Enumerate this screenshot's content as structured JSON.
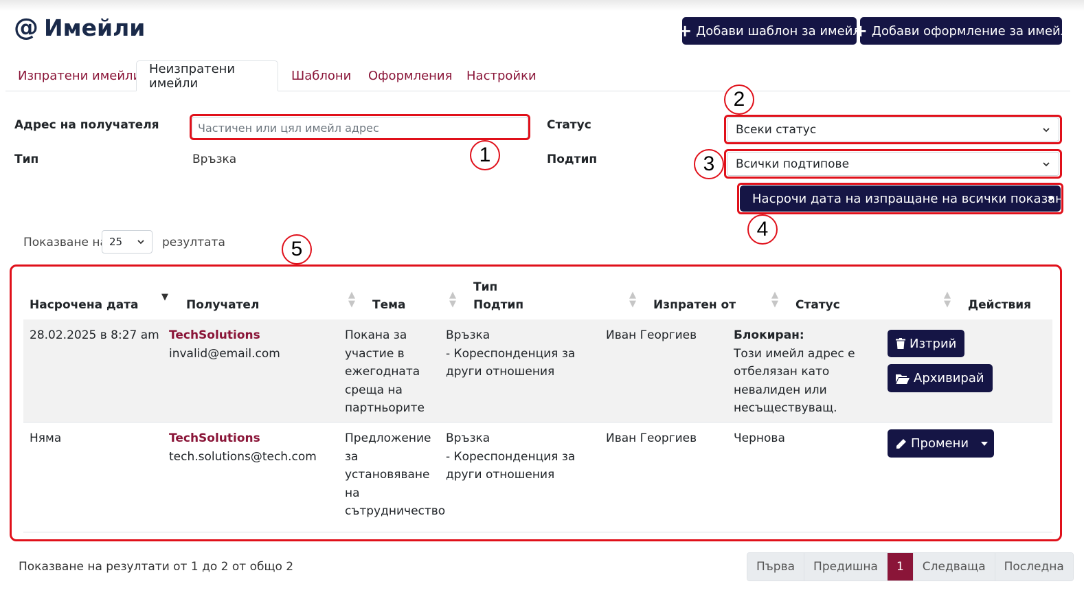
{
  "header": {
    "icon": "@",
    "title": "Имейли"
  },
  "toolbar": {
    "add_template_label": "Добави шаблон за имейл",
    "add_layout_label": "Добави оформление за имейл"
  },
  "tabs": [
    {
      "label": "Изпратени имейли"
    },
    {
      "label": "Неизпратени имейли"
    },
    {
      "label": "Шаблони"
    },
    {
      "label": "Оформления"
    },
    {
      "label": "Настройки"
    }
  ],
  "filters": {
    "recipient_label": "Адрес на получателя",
    "recipient_placeholder": "Частичен или цял имейл адрес",
    "type_label": "Тип",
    "type_value": "Връзка",
    "status_label": "Статус",
    "status_value": "Всеки статус",
    "subtype_label": "Подтип",
    "subtype_value": "Всички подтипове"
  },
  "schedule_button": "Насрочи дата на изпращане на всички показани",
  "page_size": {
    "prefix": "Показване на",
    "value": "25",
    "suffix": "резултата"
  },
  "annotations": [
    "1",
    "2",
    "3",
    "4",
    "5"
  ],
  "table": {
    "headers": {
      "date": "Насрочена дата",
      "recipient": "Получател",
      "subject": "Тема",
      "type": "Тип",
      "subtype": "Подтип",
      "sent_by": "Изпратен от",
      "status": "Статус",
      "actions": "Действия"
    },
    "rows": [
      {
        "date": "28.02.2025 в 8:27 am",
        "company": "TechSolutions",
        "email": "invalid@email.com",
        "subject_lines": [
          "Покана за",
          "участие в",
          "ежегодната",
          "среща на",
          "партньорите"
        ],
        "type": "Връзка",
        "subtype_lines": [
          "- Кореспонденция за",
          "други отношения"
        ],
        "sent_by": "Иван Георгиев",
        "status_title": "Блокиран:",
        "status_lines": [
          "Този имейл адрес е",
          "отбелязан като",
          "невалиден или",
          "несъществуващ."
        ],
        "actions": [
          "Изтрий",
          "Архивирай"
        ]
      },
      {
        "date": "Няма",
        "company": "TechSolutions",
        "email": "tech.solutions@tech.com",
        "subject_lines": [
          "Предложение",
          "за",
          "установяване",
          "на",
          "сътрудничество"
        ],
        "type": "Връзка",
        "subtype_lines": [
          "- Кореспонденция за",
          "други отношения"
        ],
        "sent_by": "Иван Георгиев",
        "status": "Чернова",
        "actions": [
          "Промени"
        ]
      }
    ]
  },
  "footer": {
    "summary": "Показване на резултати от 1 до 2 от общо 2",
    "pagination": [
      "Първа",
      "Предишна",
      "1",
      "Следваща",
      "Последна"
    ]
  },
  "colors": {
    "brand_dark": "#151545",
    "accent": "#8a1538",
    "highlight": "#e0101a"
  }
}
